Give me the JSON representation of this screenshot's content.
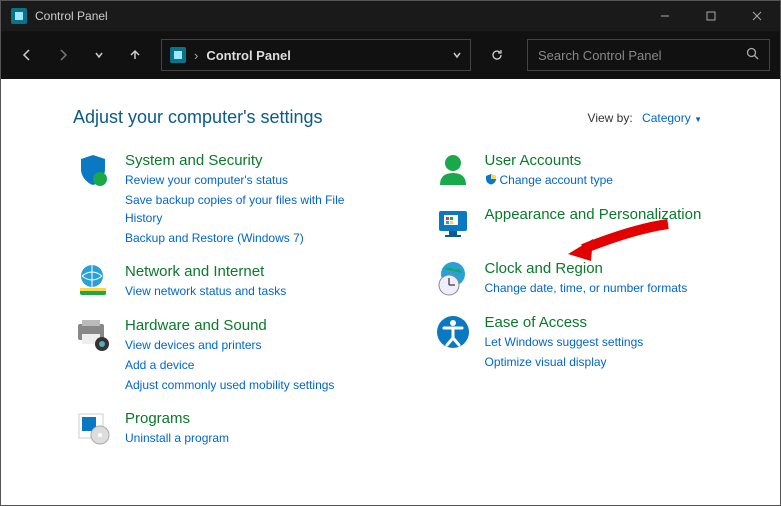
{
  "window": {
    "title": "Control Panel"
  },
  "breadcrumb": {
    "label": "Control Panel"
  },
  "search": {
    "placeholder": "Search Control Panel"
  },
  "heading": "Adjust your computer's settings",
  "viewby": {
    "label": "View by:",
    "value": "Category"
  },
  "left": [
    {
      "title": "System and Security",
      "links": [
        "Review your computer's status",
        "Save backup copies of your files with File History",
        "Backup and Restore (Windows 7)"
      ]
    },
    {
      "title": "Network and Internet",
      "links": [
        "View network status and tasks"
      ]
    },
    {
      "title": "Hardware and Sound",
      "links": [
        "View devices and printers",
        "Add a device",
        "Adjust commonly used mobility settings"
      ]
    },
    {
      "title": "Programs",
      "links": [
        "Uninstall a program"
      ]
    }
  ],
  "right": [
    {
      "title": "User Accounts",
      "links": [
        "Change account type"
      ],
      "shielded": true
    },
    {
      "title": "Appearance and Personalization",
      "links": []
    },
    {
      "title": "Clock and Region",
      "links": [
        "Change date, time, or number formats"
      ]
    },
    {
      "title": "Ease of Access",
      "links": [
        "Let Windows suggest settings",
        "Optimize visual display"
      ]
    }
  ]
}
